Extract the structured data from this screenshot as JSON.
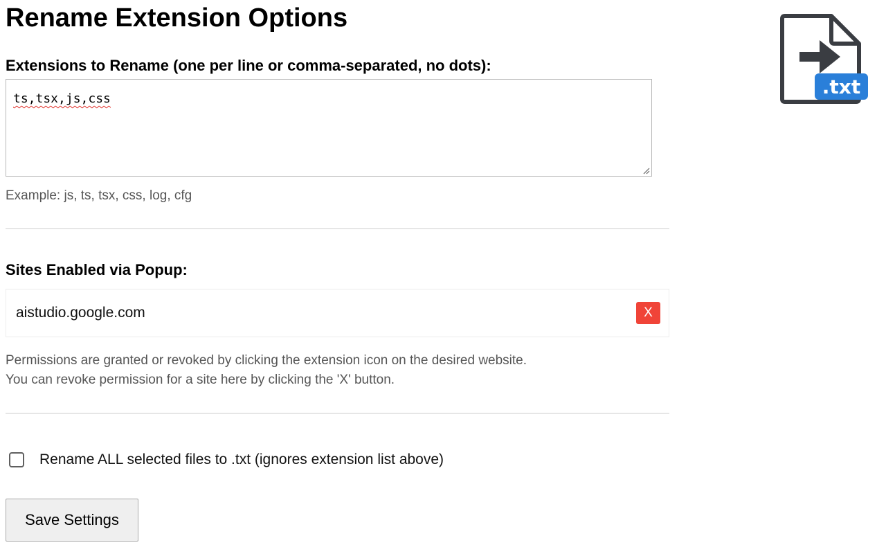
{
  "page": {
    "title": "Rename Extension Options"
  },
  "logo": {
    "icon": "file-arrow-txt-icon",
    "badge_text": ".txt",
    "badge_color": "#2a7fd9",
    "outline_color": "#3a3d42"
  },
  "extensions": {
    "label": "Extensions to Rename (one per line or comma-separated, no dots):",
    "value": "ts,tsx,js,css",
    "example": "Example: js, ts, tsx, css, log, cfg"
  },
  "sites": {
    "label": "Sites Enabled via Popup:",
    "items": [
      {
        "name": "aistudio.google.com",
        "remove_label": "X"
      }
    ],
    "remove_color": "#f04438",
    "help_line_1": "Permissions are granted or revoked by clicking the extension icon on the desired website.",
    "help_line_2": "You can revoke permission for a site here by clicking the 'X' button."
  },
  "rename_all": {
    "label": "Rename ALL selected files to .txt (ignores extension list above)",
    "checked": false
  },
  "save": {
    "label": "Save Settings"
  }
}
